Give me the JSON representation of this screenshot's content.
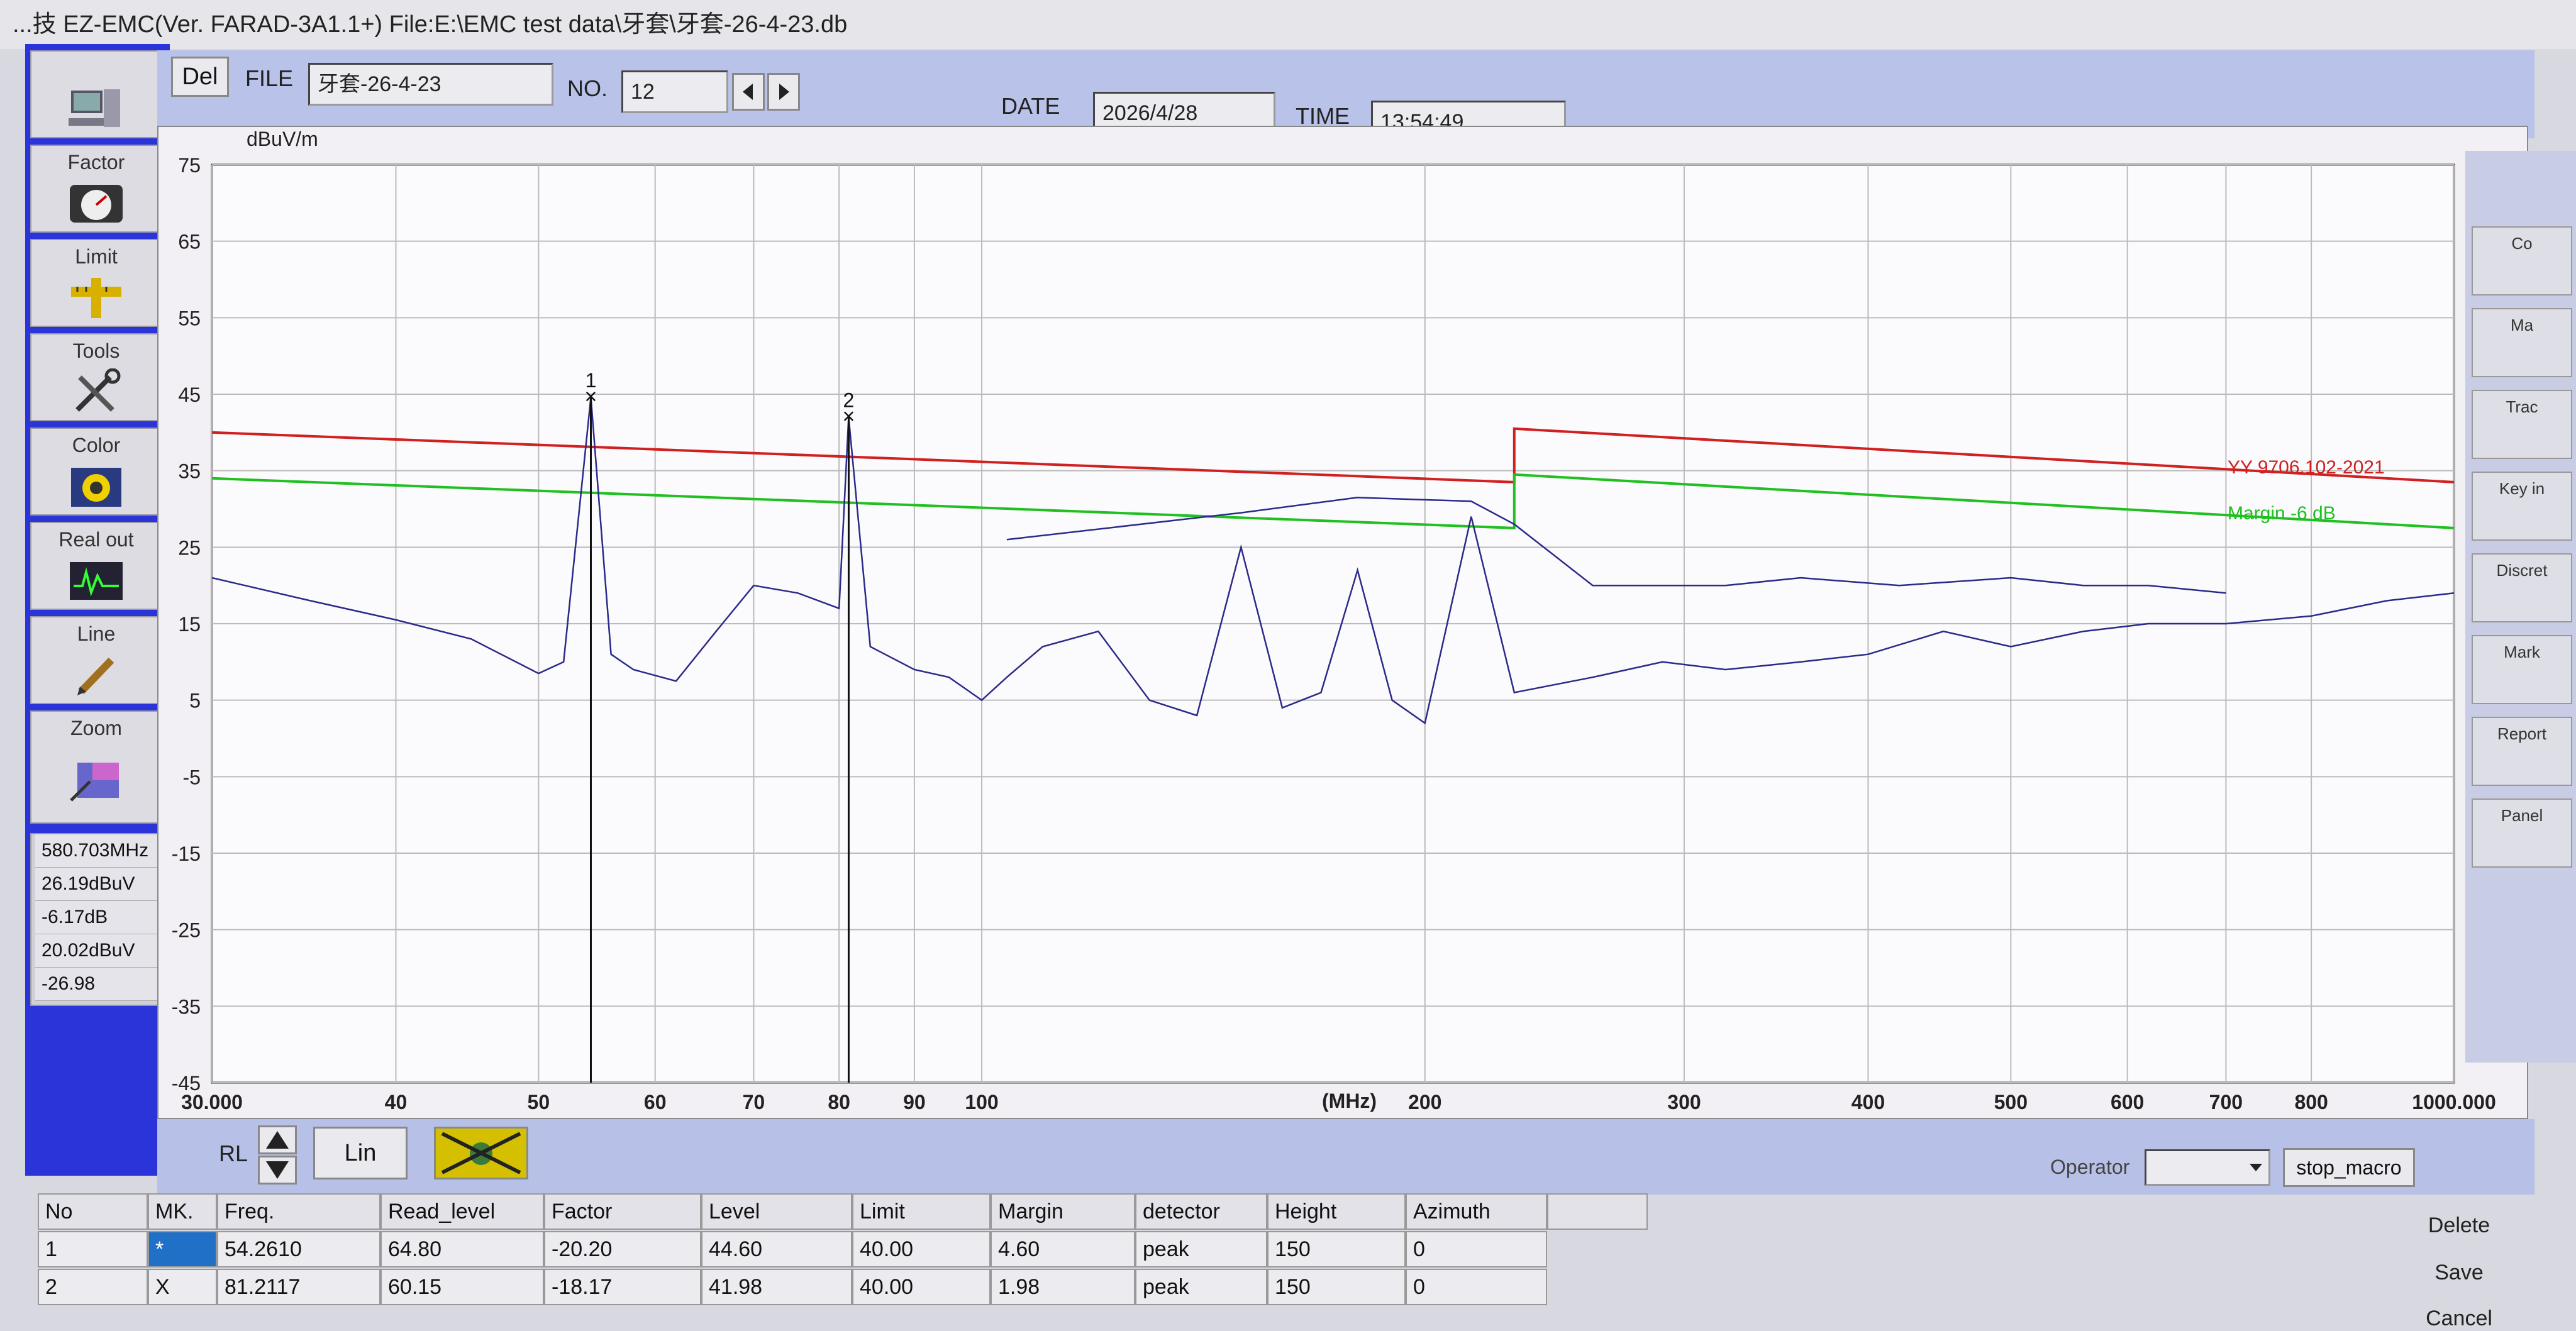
{
  "window": {
    "title": "...技 EZ-EMC(Ver. FARAD-3A1.1+)    File:E:\\EMC test data\\牙套\\牙套-26-4-23.db"
  },
  "toolbar": {
    "del_label": "Del",
    "file_label": "FILE",
    "file_value": "牙套-26-4-23",
    "no_label": "NO.",
    "no_value": "12",
    "date_label": "DATE",
    "date_value": "2026/4/28",
    "time_label": "TIME",
    "time_value": "13:54:49"
  },
  "left_tools": [
    {
      "label": "",
      "icon": "computer-icon"
    },
    {
      "label": "Factor",
      "icon": "gauge-icon"
    },
    {
      "label": "Limit",
      "icon": "ruler-icon"
    },
    {
      "label": "Tools",
      "icon": "tools-icon"
    },
    {
      "label": "Color",
      "icon": "palette-icon"
    },
    {
      "label": "Real out",
      "icon": "scope-icon"
    },
    {
      "label": "Line",
      "icon": "pen-icon"
    },
    {
      "label": "Zoom",
      "icon": "zoom-icon"
    }
  ],
  "readout": [
    "580.703MHz",
    "26.19dBuV",
    "-6.17dB",
    "20.02dBuV",
    "-26.98"
  ],
  "right_tools": [
    {
      "label": "Co"
    },
    {
      "label": "Ma"
    },
    {
      "label": "Trac"
    },
    {
      "label": "Key in"
    },
    {
      "label": "Discret"
    },
    {
      "label": "Mark"
    },
    {
      "label": "Report"
    },
    {
      "label": "Panel"
    }
  ],
  "bottom": {
    "rl_label": "RL",
    "lin_label": "Lin",
    "operator_label": "Operator",
    "stop_macro_label": "stop_macro"
  },
  "side_actions": {
    "delete": "Delete",
    "save": "Save",
    "cancel": "Cancel"
  },
  "table": {
    "headers": [
      "No",
      "MK.",
      "Freq.",
      "Read_level",
      "Factor",
      "Level",
      "Limit",
      "Margin",
      "detector",
      "Height",
      "Azimuth"
    ],
    "rows": [
      [
        "1",
        "*",
        "54.2610",
        "64.80",
        "-20.20",
        "44.60",
        "40.00",
        "4.60",
        "peak",
        "150",
        "0"
      ],
      [
        "2",
        "X",
        "81.2117",
        "60.15",
        "-18.17",
        "41.98",
        "40.00",
        "1.98",
        "peak",
        "150",
        "0"
      ]
    ]
  },
  "chart_data": {
    "type": "line",
    "ylabel": "dBuV/m",
    "xlabel": "(MHz)",
    "x_scale": "log",
    "xlim": [
      30,
      1000
    ],
    "ylim": [
      -45,
      75
    ],
    "y_ticks": [
      75,
      65,
      55,
      45,
      35,
      25,
      15,
      5,
      -5,
      -15,
      -25,
      -35,
      -45
    ],
    "x_ticks": [
      {
        "v": 30,
        "label": "30.000"
      },
      {
        "v": 40,
        "label": "40"
      },
      {
        "v": 50,
        "label": "50"
      },
      {
        "v": 60,
        "label": "60"
      },
      {
        "v": 70,
        "label": "70"
      },
      {
        "v": 80,
        "label": "80"
      },
      {
        "v": 90,
        "label": "90"
      },
      {
        "v": 100,
        "label": "100"
      },
      {
        "v": 200,
        "label": "200"
      },
      {
        "v": 300,
        "label": "300"
      },
      {
        "v": 400,
        "label": "400"
      },
      {
        "v": 500,
        "label": "500"
      },
      {
        "v": 600,
        "label": "600"
      },
      {
        "v": 700,
        "label": "700"
      },
      {
        "v": 800,
        "label": "800"
      },
      {
        "v": 1000,
        "label": "1000.000"
      }
    ],
    "grid": true,
    "series": [
      {
        "name": "YY 9706.102-2021",
        "color": "#d02020",
        "x": [
          30,
          230,
          230,
          1000
        ],
        "y": [
          40,
          33.5,
          40.5,
          33.5
        ]
      },
      {
        "name": "Margin -6 dB",
        "color": "#20c020",
        "x": [
          30,
          230,
          230,
          1000
        ],
        "y": [
          34,
          27.5,
          34.5,
          27.5
        ]
      },
      {
        "name": "",
        "color": "#2a2a8a",
        "x": [
          30,
          35,
          40,
          45,
          50,
          52,
          54.26,
          56,
          58,
          62,
          66,
          70,
          75,
          80,
          81.21,
          84,
          90,
          95,
          100,
          104,
          110,
          120,
          130,
          140,
          150,
          160,
          170,
          180,
          190,
          200,
          215,
          230,
          260,
          290,
          320,
          360,
          400,
          450,
          500,
          560,
          620,
          700,
          800,
          900,
          1000
        ],
        "y": [
          21,
          18,
          15.5,
          13,
          8.5,
          10,
          44.6,
          11,
          9,
          7.5,
          14,
          20,
          19,
          17,
          41.98,
          12,
          9,
          8,
          5,
          8,
          12,
          14,
          5,
          3,
          25,
          4,
          6,
          22,
          5,
          2,
          29,
          6,
          8,
          10,
          9,
          10,
          11,
          14,
          12,
          14,
          15,
          15,
          16,
          18,
          19
        ]
      },
      {
        "name": "",
        "color": "#2a2a8a",
        "x": [
          104,
          150,
          180,
          215,
          230,
          260,
          320,
          360,
          420,
          500,
          560,
          620,
          700
        ],
        "y": [
          26,
          29.5,
          31.5,
          31,
          28,
          20,
          20,
          21,
          20,
          21,
          20,
          20,
          19
        ]
      }
    ],
    "markers": [
      {
        "label": "1",
        "x": 54.261,
        "y": 44.6
      },
      {
        "label": "2",
        "x": 81.2117,
        "y": 41.98
      }
    ]
  }
}
